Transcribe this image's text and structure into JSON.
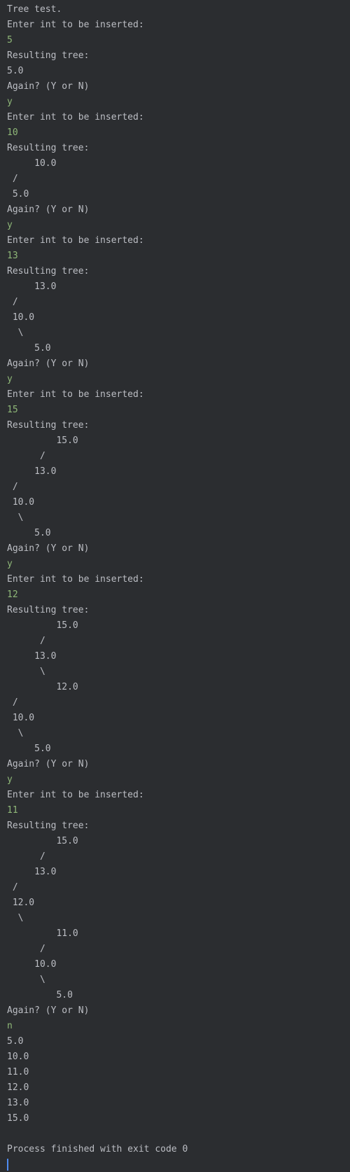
{
  "console": {
    "lines": [
      {
        "text": "Tree test.",
        "kind": "output"
      },
      {
        "text": "Enter int to be inserted:",
        "kind": "output"
      },
      {
        "text": "5",
        "kind": "input"
      },
      {
        "text": "Resulting tree:",
        "kind": "output"
      },
      {
        "text": "5.0",
        "kind": "output"
      },
      {
        "text": "Again? (Y or N)",
        "kind": "output"
      },
      {
        "text": "y",
        "kind": "input"
      },
      {
        "text": "Enter int to be inserted:",
        "kind": "output"
      },
      {
        "text": "10",
        "kind": "input"
      },
      {
        "text": "Resulting tree:",
        "kind": "output"
      },
      {
        "text": "     10.0",
        "kind": "output"
      },
      {
        "text": " /",
        "kind": "output"
      },
      {
        "text": " 5.0",
        "kind": "output"
      },
      {
        "text": "Again? (Y or N)",
        "kind": "output"
      },
      {
        "text": "y",
        "kind": "input"
      },
      {
        "text": "Enter int to be inserted:",
        "kind": "output"
      },
      {
        "text": "13",
        "kind": "input"
      },
      {
        "text": "Resulting tree:",
        "kind": "output"
      },
      {
        "text": "     13.0",
        "kind": "output"
      },
      {
        "text": " /",
        "kind": "output"
      },
      {
        "text": " 10.0",
        "kind": "output"
      },
      {
        "text": "  \\",
        "kind": "output"
      },
      {
        "text": "     5.0",
        "kind": "output"
      },
      {
        "text": "Again? (Y or N)",
        "kind": "output"
      },
      {
        "text": "y",
        "kind": "input"
      },
      {
        "text": "Enter int to be inserted:",
        "kind": "output"
      },
      {
        "text": "15",
        "kind": "input"
      },
      {
        "text": "Resulting tree:",
        "kind": "output"
      },
      {
        "text": "         15.0",
        "kind": "output"
      },
      {
        "text": "      /",
        "kind": "output"
      },
      {
        "text": "     13.0",
        "kind": "output"
      },
      {
        "text": " /",
        "kind": "output"
      },
      {
        "text": " 10.0",
        "kind": "output"
      },
      {
        "text": "  \\",
        "kind": "output"
      },
      {
        "text": "     5.0",
        "kind": "output"
      },
      {
        "text": "Again? (Y or N)",
        "kind": "output"
      },
      {
        "text": "y",
        "kind": "input"
      },
      {
        "text": "Enter int to be inserted:",
        "kind": "output"
      },
      {
        "text": "12",
        "kind": "input"
      },
      {
        "text": "Resulting tree:",
        "kind": "output"
      },
      {
        "text": "         15.0",
        "kind": "output"
      },
      {
        "text": "      /",
        "kind": "output"
      },
      {
        "text": "     13.0",
        "kind": "output"
      },
      {
        "text": "      \\",
        "kind": "output"
      },
      {
        "text": "         12.0",
        "kind": "output"
      },
      {
        "text": " /",
        "kind": "output"
      },
      {
        "text": " 10.0",
        "kind": "output"
      },
      {
        "text": "  \\",
        "kind": "output"
      },
      {
        "text": "     5.0",
        "kind": "output"
      },
      {
        "text": "Again? (Y or N)",
        "kind": "output"
      },
      {
        "text": "y",
        "kind": "input"
      },
      {
        "text": "Enter int to be inserted:",
        "kind": "output"
      },
      {
        "text": "11",
        "kind": "input"
      },
      {
        "text": "Resulting tree:",
        "kind": "output"
      },
      {
        "text": "         15.0",
        "kind": "output"
      },
      {
        "text": "      /",
        "kind": "output"
      },
      {
        "text": "     13.0",
        "kind": "output"
      },
      {
        "text": " /",
        "kind": "output"
      },
      {
        "text": " 12.0",
        "kind": "output"
      },
      {
        "text": "  \\",
        "kind": "output"
      },
      {
        "text": "         11.0",
        "kind": "output"
      },
      {
        "text": "      /",
        "kind": "output"
      },
      {
        "text": "     10.0",
        "kind": "output"
      },
      {
        "text": "      \\",
        "kind": "output"
      },
      {
        "text": "         5.0",
        "kind": "output"
      },
      {
        "text": "Again? (Y or N)",
        "kind": "output"
      },
      {
        "text": "n",
        "kind": "input"
      },
      {
        "text": "5.0",
        "kind": "output"
      },
      {
        "text": "10.0",
        "kind": "output"
      },
      {
        "text": "11.0",
        "kind": "output"
      },
      {
        "text": "12.0",
        "kind": "output"
      },
      {
        "text": "13.0",
        "kind": "output"
      },
      {
        "text": "15.0",
        "kind": "output"
      },
      {
        "text": "",
        "kind": "output"
      },
      {
        "text": "Process finished with exit code 0",
        "kind": "system"
      }
    ]
  },
  "colors": {
    "background": "#2b2d30",
    "output_text": "#bcbec4",
    "input_text": "#8fb878",
    "caret": "#4f8cf0"
  }
}
